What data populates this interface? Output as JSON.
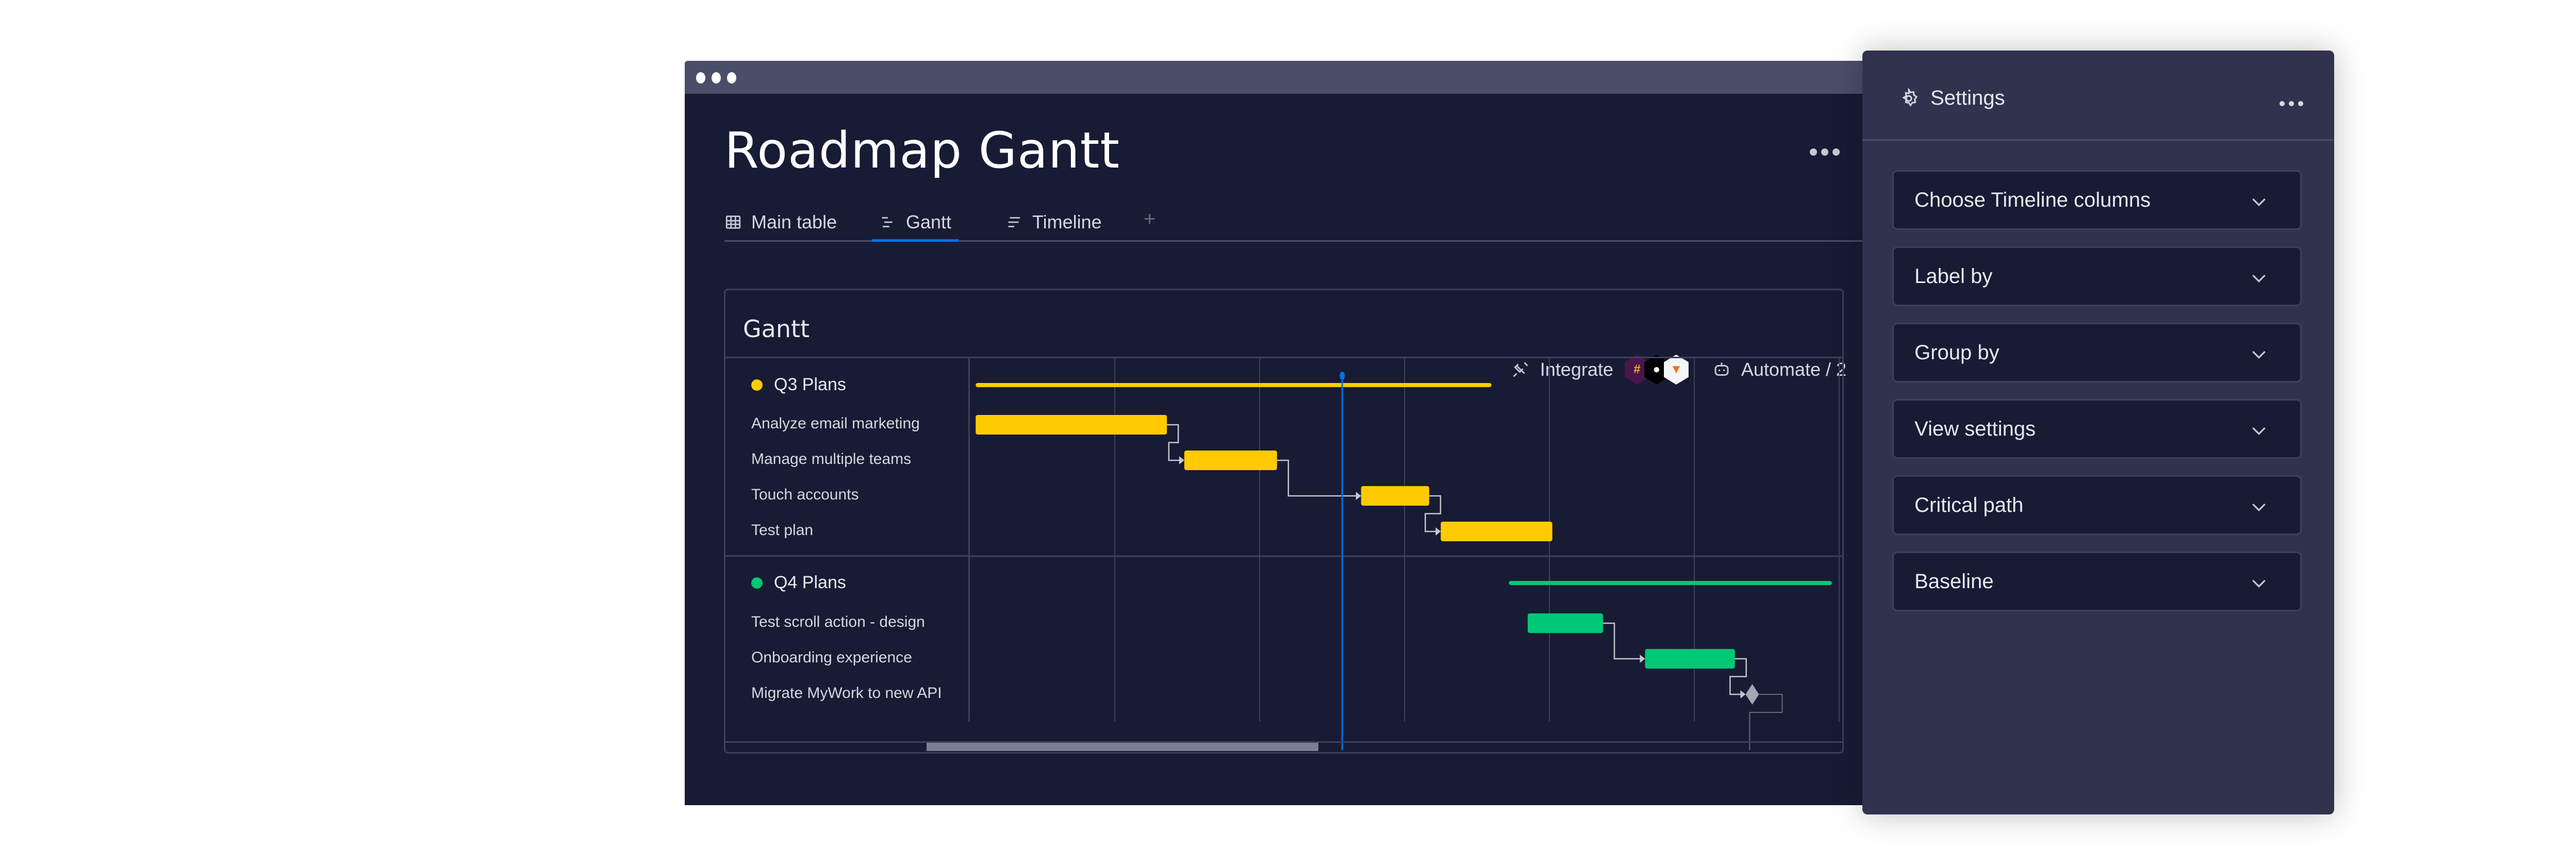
{
  "window": {
    "title": "Roadmap Gantt",
    "more_menu_icon": "more-horizontal-icon"
  },
  "tabs": [
    {
      "label": "Main table",
      "icon": "table-icon",
      "active": false
    },
    {
      "label": "Gantt",
      "icon": "gantt-icon",
      "active": true
    },
    {
      "label": "Timeline",
      "icon": "timeline-icon",
      "active": false
    }
  ],
  "add_tab_label": "+",
  "toolbar": {
    "integrate_label": "Integrate",
    "integrations": [
      "Slack",
      "GitHub",
      "GitLab"
    ],
    "automate_label": "Automate / 2"
  },
  "gantt": {
    "title": "Gantt",
    "groups": [
      {
        "name": "Q3 Plans",
        "color": "#ffcb00",
        "items": [
          "Analyze email marketing",
          "Manage multiple teams",
          "Touch accounts",
          "Test plan"
        ]
      },
      {
        "name": "Q4 Plans",
        "color": "#00c875",
        "items": [
          "Test scroll action - design",
          "Onboarding experience",
          "Migrate MyWork to new API"
        ]
      }
    ],
    "today_color": "#0073ea",
    "scroll_position": 0.22
  },
  "chart_data": {
    "type": "gantt",
    "time_unit": "column",
    "columns": 6,
    "today": 2.57,
    "groups": [
      {
        "name": "Q3 Plans",
        "color": "#ffcb00",
        "span": [
          0.04,
          3.6
        ]
      },
      {
        "name": "Q4 Plans",
        "color": "#00c875",
        "span": [
          3.72,
          5.95
        ]
      }
    ],
    "tasks": [
      {
        "name": "Analyze email marketing",
        "group": "Q3 Plans",
        "start": 0.04,
        "end": 1.36,
        "type": "task"
      },
      {
        "name": "Manage multiple teams",
        "group": "Q3 Plans",
        "start": 1.48,
        "end": 2.12,
        "type": "task",
        "depends_on": "Analyze email marketing"
      },
      {
        "name": "Touch accounts",
        "group": "Q3 Plans",
        "start": 2.7,
        "end": 3.17,
        "type": "task",
        "depends_on": "Manage multiple teams"
      },
      {
        "name": "Test plan",
        "group": "Q3 Plans",
        "start": 3.25,
        "end": 4.02,
        "type": "task",
        "depends_on": "Touch accounts"
      },
      {
        "name": "Test scroll action - design",
        "group": "Q4 Plans",
        "start": 3.85,
        "end": 4.37,
        "type": "task"
      },
      {
        "name": "Onboarding experience",
        "group": "Q4 Plans",
        "start": 4.66,
        "end": 5.28,
        "type": "task",
        "depends_on": "Test scroll action - design"
      },
      {
        "name": "Migrate MyWork to new API",
        "group": "Q4 Plans",
        "at": 5.4,
        "type": "milestone",
        "depends_on": "Onboarding experience"
      }
    ]
  },
  "settings": {
    "title": "Settings",
    "sections": [
      "Choose Timeline columns",
      "Label by",
      "Group by",
      "View settings",
      "Critical path",
      "Baseline"
    ]
  }
}
